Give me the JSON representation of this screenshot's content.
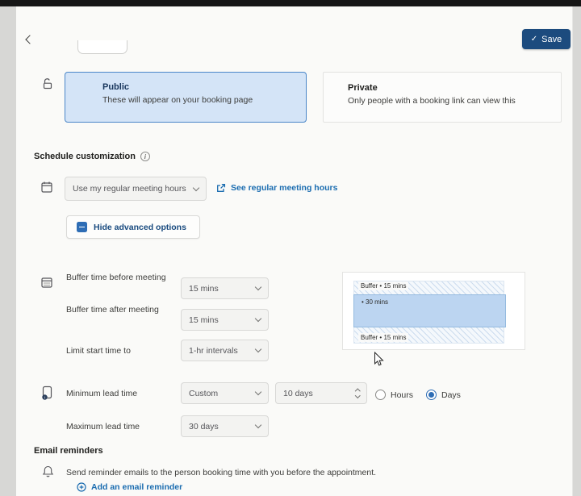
{
  "header": {
    "save_label": "Save"
  },
  "icons": {
    "check": "✓",
    "info": "i"
  },
  "visibility": {
    "public_title": "Public",
    "public_desc": "These will appear on your booking page",
    "private_title": "Private",
    "private_desc": "Only people with a booking link can view this"
  },
  "schedule": {
    "heading": "Schedule customization",
    "hours_value": "Use my regular meeting hours",
    "see_hours_label": "See regular meeting hours",
    "hide_advanced_label": "Hide advanced options"
  },
  "advanced": {
    "buffer_before_label": "Buffer time before meeting",
    "buffer_before_value": "15 mins",
    "buffer_after_label": "Buffer time after meeting",
    "buffer_after_value": "15 mins",
    "limit_label": "Limit start time to",
    "limit_value": "1-hr intervals",
    "diagram": {
      "buffer_top": "Buffer • 15 mins",
      "meeting": "• 30 mins",
      "buffer_bottom": "Buffer • 15 mins"
    },
    "min_lead_label": "Minimum lead time",
    "min_lead_type": "Custom",
    "min_lead_value": "10 days",
    "unit_hours": "Hours",
    "unit_days": "Days",
    "selected_unit": "Days",
    "max_lead_label": "Maximum lead time",
    "max_lead_value": "30 days"
  },
  "email": {
    "heading": "Email reminders",
    "description": "Send reminder emails to the person booking time with you before the appointment.",
    "add_label": "Add an email reminder"
  },
  "colors": {
    "accent_blue": "#1a6cb0",
    "save_button": "#1c4b7e",
    "selected_card_bg": "#d4e4f7",
    "selected_card_border": "#4a86c8"
  }
}
